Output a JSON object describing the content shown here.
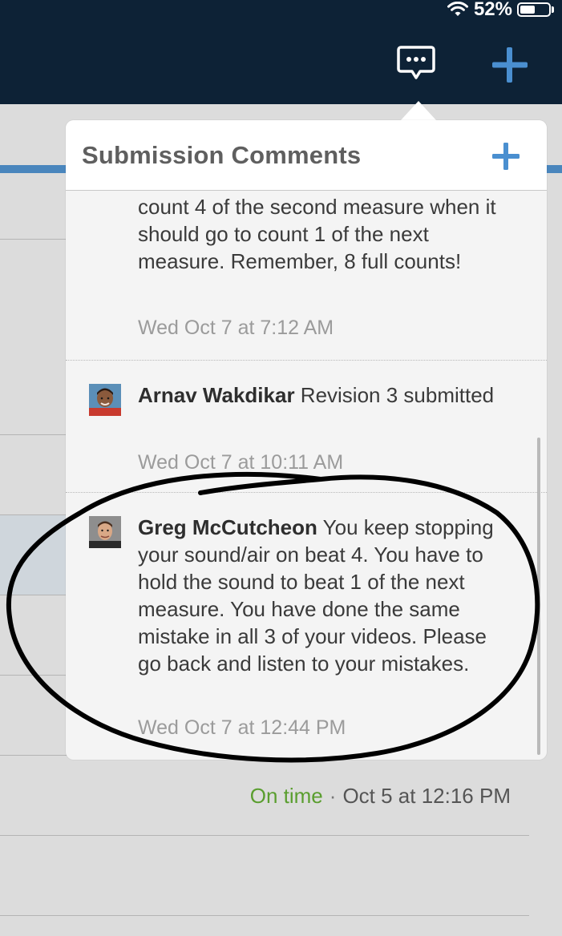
{
  "status_bar": {
    "battery": "52%",
    "battery_level": 0.52
  },
  "header": {
    "comments_icon": "speech-bubble-ellipsis-icon",
    "add_icon": "plus-icon"
  },
  "popover": {
    "title": "Submission Comments",
    "add_icon": "plus-icon",
    "comments": [
      {
        "author": "",
        "text": "count 4 of the second measure when it should go to count 1 of the next measure.  Remember, 8 full counts!",
        "date": "Wed Oct 7 at 7:12 AM"
      },
      {
        "author": "Arnav Wakdikar",
        "text": " Revision 3 submitted",
        "date": "Wed Oct 7 at 10:11 AM"
      },
      {
        "author": "Greg McCutcheon",
        "text": " You keep stopping your sound/air on beat 4.  You have to hold the sound to beat 1 of the next measure.  You have done the same mistake in all 3 of your videos.  Please go back and listen to your mistakes.",
        "date": "Wed Oct 7 at 12:44 PM"
      }
    ]
  },
  "background": {
    "status_label": "On time",
    "separator": "·",
    "submitted_date": "Oct 5 at 12:16 PM"
  },
  "colors": {
    "app_bar": "#0d2236",
    "accent": "#4a86bd",
    "on_time": "#5a9e2f"
  }
}
